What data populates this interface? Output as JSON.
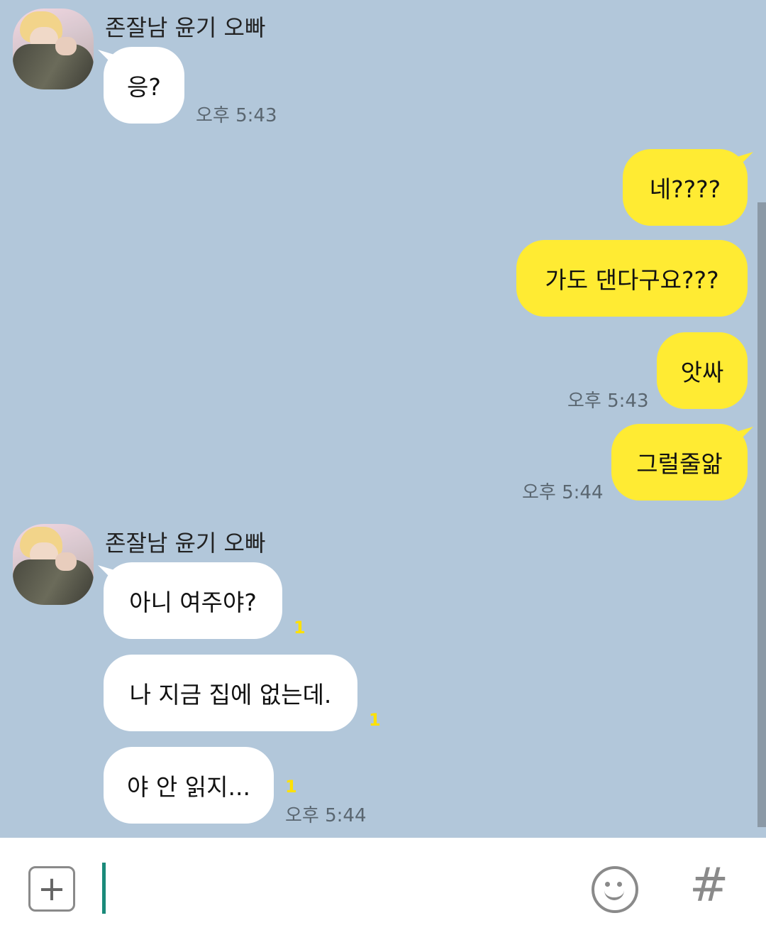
{
  "chat": {
    "sender_name": "존잘남 윤기 오빠",
    "messages": [
      {
        "text": "응?",
        "time": "오후 5:43"
      },
      {
        "text": "네????"
      },
      {
        "text": "가도 댄다구요???"
      },
      {
        "text": "앗싸",
        "time": "오후 5:43"
      },
      {
        "text": "그럴줄앎",
        "time": "오후 5:44"
      },
      {
        "text": "아니 여주야?",
        "unread": "1"
      },
      {
        "text": "나 지금 집에 없는데.",
        "unread": "1"
      },
      {
        "text": "야 안 읽지...",
        "unread": "1",
        "time": "오후 5:44"
      }
    ]
  },
  "input": {
    "placeholder": "",
    "plus_icon": "plus-icon",
    "emoji_icon": "emoticon-icon",
    "hash_icon": "hash-icon",
    "hash_glyph": "#"
  },
  "colors": {
    "background": "#b2c7da",
    "incoming_bubble": "#ffffff",
    "outgoing_bubble": "#ffeb33",
    "unread": "#ffe100",
    "cursor": "#1a8a7a"
  }
}
